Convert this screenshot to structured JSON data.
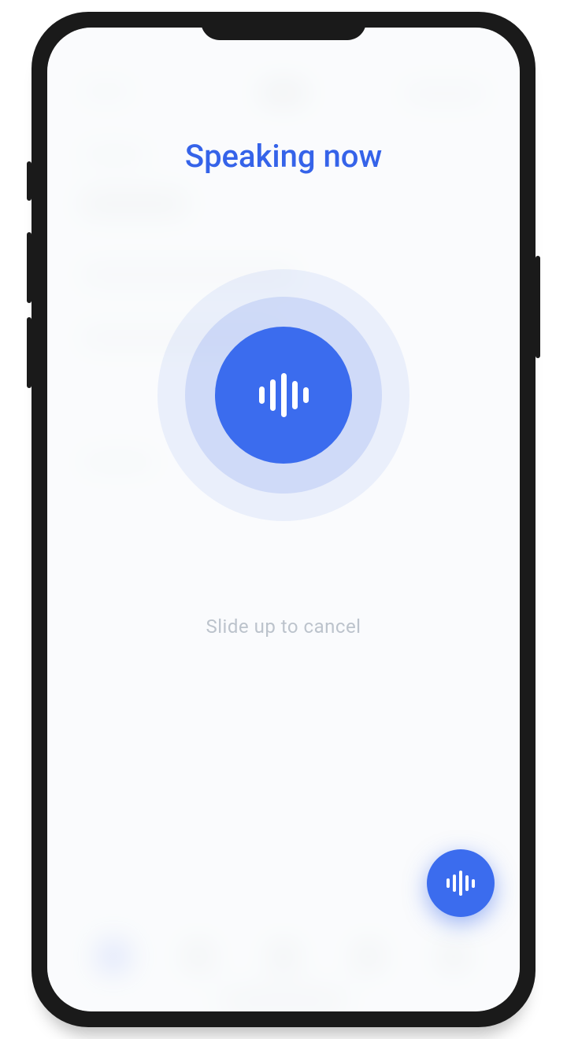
{
  "voice_overlay": {
    "title": "Speaking now",
    "hint": "Slide up to cancel"
  },
  "colors": {
    "primary": "#3b6cee"
  }
}
